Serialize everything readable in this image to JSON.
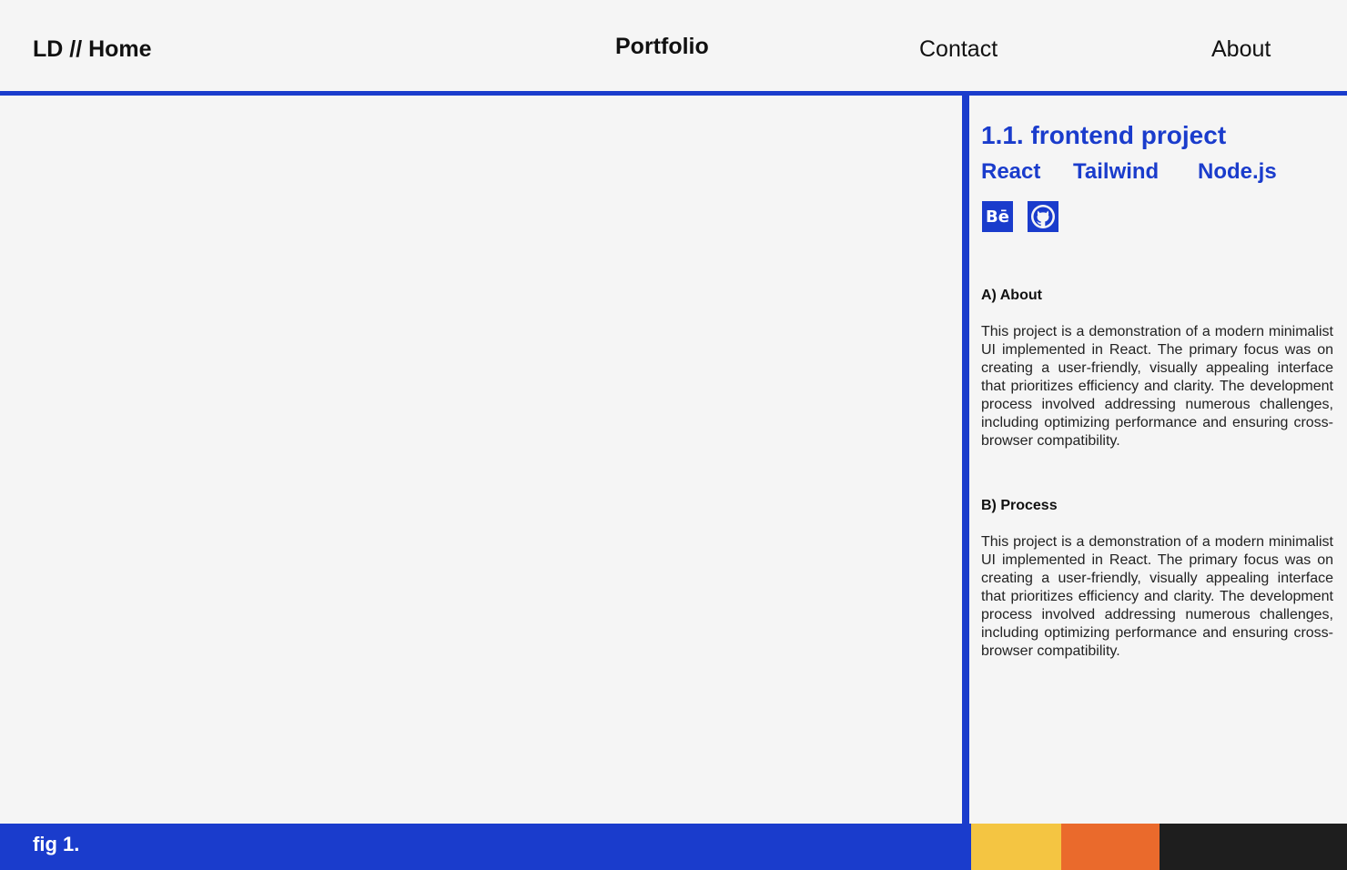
{
  "nav": {
    "home": "LD // Home",
    "portfolio": "Portfolio",
    "contact": "Contact",
    "about": "About"
  },
  "project": {
    "title": "1.1. frontend project",
    "tags": [
      "React",
      "Tailwind",
      "Node.js"
    ],
    "links": [
      {
        "icon": "behance-icon",
        "label": "Bē"
      },
      {
        "icon": "github-icon"
      }
    ],
    "sections": [
      {
        "heading": "A) About",
        "body": "This project is a demonstration of a modern minimalist UI implemented in React. The primary focus was on creating a user-friendly, visually appealing interface that prioritizes efficiency and clarity. The development process involved addressing numerous challenges, including optimizing performance and ensuring cross-browser compatibility."
      },
      {
        "heading": "B) Process",
        "body": "This project is a demonstration of a modern minimalist UI implemented in React. The primary focus was on creating a user-friendly, visually appealing interface that prioritizes efficiency and clarity. The development process involved addressing numerous challenges, including optimizing performance and ensuring cross-browser compatibility."
      }
    ]
  },
  "footer": {
    "label": "fig 1.",
    "swatches": [
      "#f4c542",
      "#ea6a2c",
      "#1e1e1e"
    ]
  },
  "colors": {
    "accent": "#1a3ccc",
    "background": "#f5f5f5"
  }
}
